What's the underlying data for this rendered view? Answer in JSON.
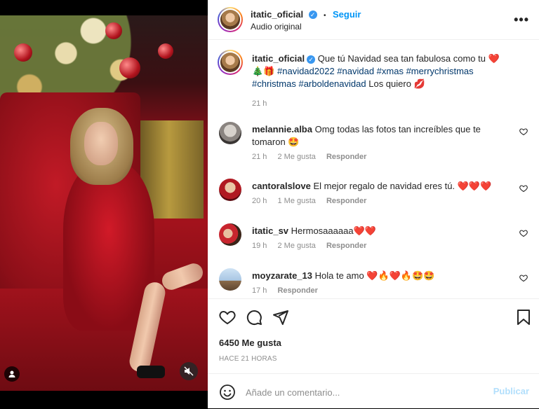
{
  "post": {
    "username": "itatic_oficial",
    "follow_label": "Seguir",
    "audio": "Audio original",
    "caption_main": "Que tú Navidad sea tan fabulosa como tu ❤️🎄🎁",
    "hashtags": "#navidad2022 #navidad #xmas #merrychristmas #christmas #arboldenavidad",
    "caption_end": "Los quiero 💋",
    "caption_time": "21 h"
  },
  "comments": [
    {
      "user": "melannie.alba",
      "text": "Omg todas las fotos tan increíbles que te tomaron 🤩",
      "time": "21 h",
      "likes": "2 Me gusta",
      "reply": "Responder"
    },
    {
      "user": "cantoralslove",
      "text": "El mejor regalo de navidad eres tú. ❤️❤️❤️",
      "time": "20 h",
      "likes": "1 Me gusta",
      "reply": "Responder"
    },
    {
      "user": "itatic_sv",
      "text": "Hermosaaaaaa❤️❤️",
      "time": "19 h",
      "likes": "2 Me gusta",
      "reply": "Responder"
    },
    {
      "user": "moyzarate_13",
      "text": "Hola te amo ❤️🔥❤️🔥🤩🤩",
      "time": "17 h",
      "likes": "",
      "reply": "Responder"
    }
  ],
  "footer": {
    "likes": "6450 Me gusta",
    "posted": "HACE 21 HORAS",
    "comment_placeholder": "Añade un comentario...",
    "publish": "Publicar"
  },
  "icons": [
    "more-icon",
    "heart-icon",
    "comment-icon",
    "share-icon",
    "bookmark-icon",
    "emoji-icon",
    "mute-icon",
    "user-tag-icon",
    "verified-badge"
  ],
  "colors": {
    "link": "#0095f6",
    "hashtag": "#00376b",
    "muted": "#8e8e8e",
    "publish_disabled": "#b2dffc"
  }
}
